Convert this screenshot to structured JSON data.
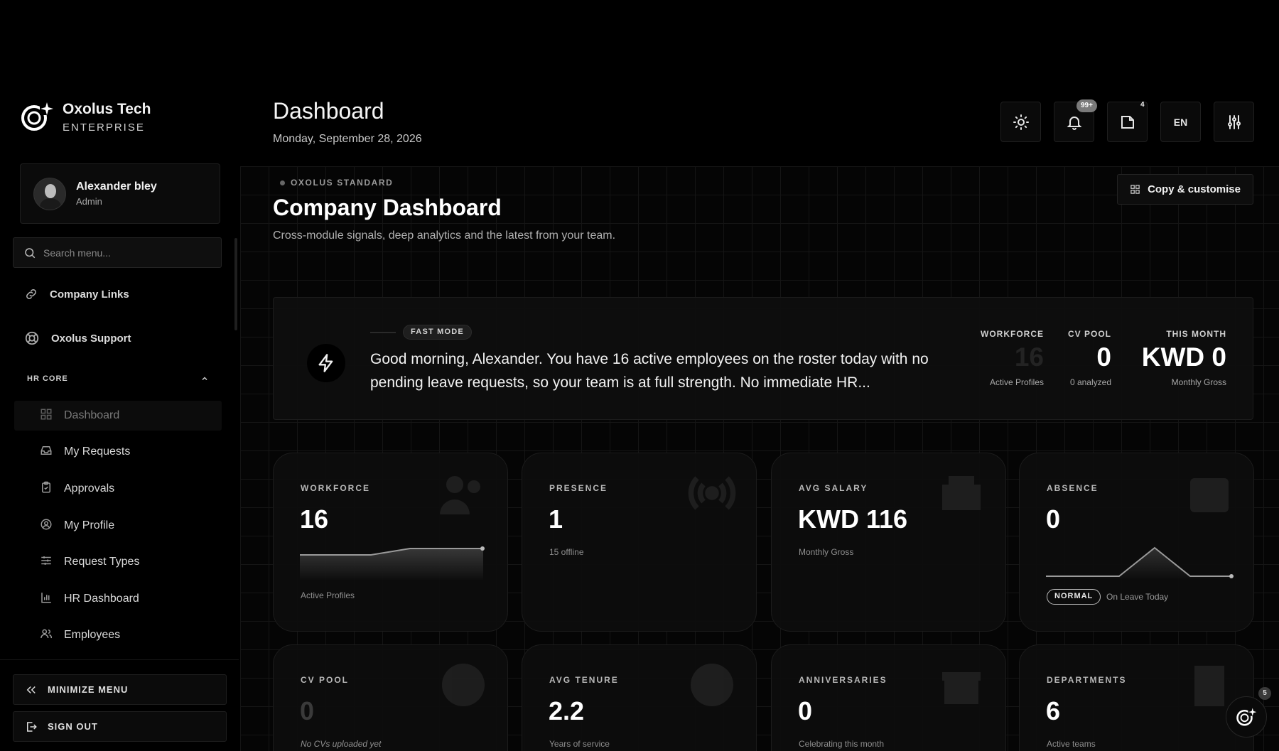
{
  "brand": {
    "name": "Oxolus Tech",
    "tier": "ENTERPRISE"
  },
  "user": {
    "name": "Alexander bley",
    "role": "Admin"
  },
  "search": {
    "placeholder": "Search menu..."
  },
  "nav": {
    "company_links": "Company Links",
    "support": "Oxolus Support",
    "section": "HR CORE",
    "items": [
      {
        "label": "Dashboard",
        "icon": "grid-icon",
        "active": true
      },
      {
        "label": "My Requests",
        "icon": "inbox-icon"
      },
      {
        "label": "Approvals",
        "icon": "clipboard-icon"
      },
      {
        "label": "My Profile",
        "icon": "user-circle-icon"
      },
      {
        "label": "Request Types",
        "icon": "sliders-icon"
      },
      {
        "label": "HR Dashboard",
        "icon": "bar-chart-icon"
      },
      {
        "label": "Employees",
        "icon": "users-icon"
      }
    ],
    "minimize": "MINIMIZE MENU",
    "sign_out": "SIGN OUT"
  },
  "header": {
    "title": "Dashboard",
    "date": "Monday, September 28, 2026",
    "notif_badge": "99+",
    "docs_badge": "4",
    "lang": "EN"
  },
  "dashboard": {
    "eyebrow": "OXOLUS STANDARD",
    "title": "Company Dashboard",
    "subtitle": "Cross-module signals, deep analytics and the latest from your team.",
    "copy_button": "Copy & customise"
  },
  "brief": {
    "mode": "FAST MODE",
    "text": "Good morning, Alexander. You have 16 active employees on the roster today with no pending leave requests, so your team is at full strength. No immediate HR...",
    "stats": [
      {
        "label": "WORKFORCE",
        "value": "16",
        "note": "Active Profiles"
      },
      {
        "label": "CV POOL",
        "value": "0",
        "note": "0 analyzed"
      },
      {
        "label": "THIS MONTH",
        "value": "KWD 0",
        "note": "Monthly Gross"
      }
    ]
  },
  "cards": [
    {
      "label": "WORKFORCE",
      "value": "16",
      "note": "Active Profiles"
    },
    {
      "label": "PRESENCE",
      "value": "1",
      "note": "15 offline"
    },
    {
      "label": "AVG SALARY",
      "value": "KWD 116",
      "note": "Monthly Gross"
    },
    {
      "label": "ABSENCE",
      "value": "0",
      "pill": "NORMAL",
      "note": "On Leave Today"
    },
    {
      "label": "CV POOL",
      "value": "0",
      "note": "No CVs uploaded yet"
    },
    {
      "label": "AVG TENURE",
      "value": "2.2",
      "note": "Years of service"
    },
    {
      "label": "ANNIVERSARIES",
      "value": "0",
      "note": "Celebrating this month"
    },
    {
      "label": "DEPARTMENTS",
      "value": "6",
      "note": "Active teams"
    }
  ],
  "assistant": {
    "badge": "5"
  }
}
